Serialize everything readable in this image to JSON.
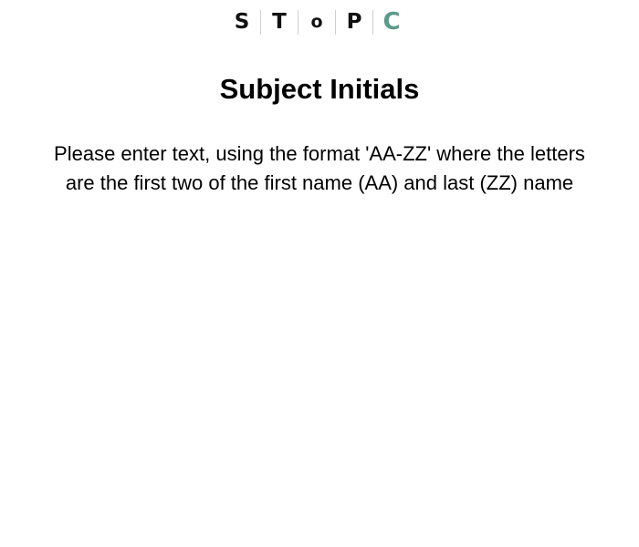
{
  "logo": {
    "letters": [
      "S",
      "T",
      "o",
      "P",
      "C"
    ],
    "accent_color": "#5b9a8b",
    "text_color": "#111111"
  },
  "page": {
    "title": "Subject Initials",
    "instructions": "Please enter text, using the format 'AA-ZZ' where the letters are the first two of the first name (AA) and last (ZZ) name"
  }
}
